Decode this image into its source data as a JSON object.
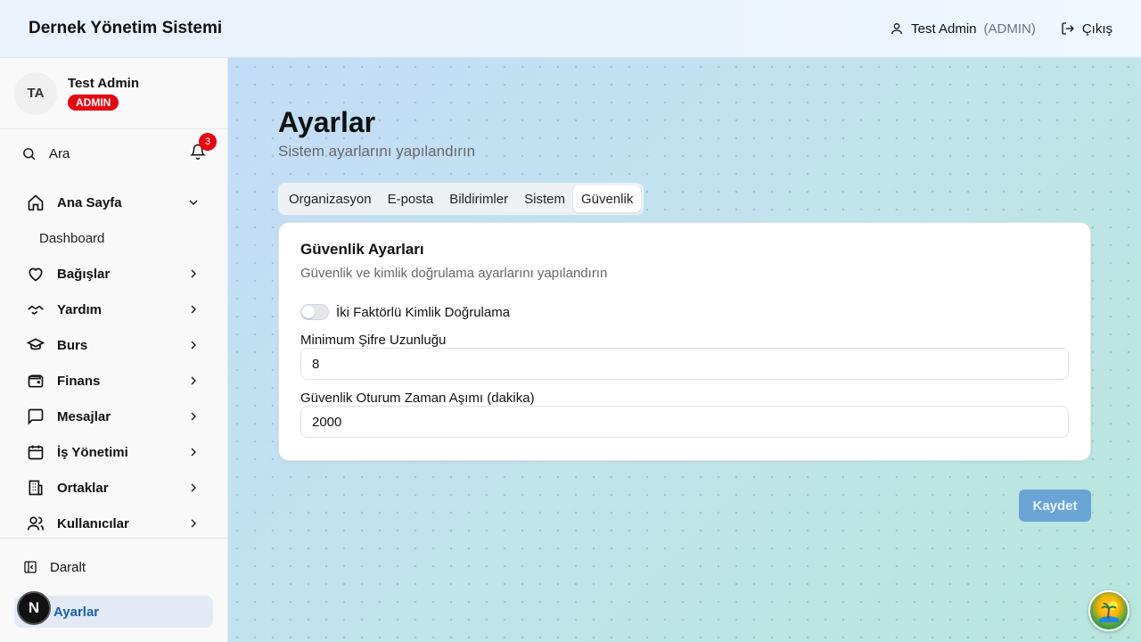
{
  "header": {
    "app_title": "Dernek Yönetim Sistemi",
    "user_name": "Test Admin",
    "user_role": "(ADMIN)",
    "logout_label": "Çıkış"
  },
  "sidebar": {
    "profile": {
      "initials": "TA",
      "name": "Test Admin",
      "role_badge": "ADMIN"
    },
    "search_label": "Ara",
    "notification_count": "3",
    "items": [
      {
        "label": "Ana Sayfa",
        "icon": "home-icon",
        "expanded": true
      },
      {
        "label": "Dashboard",
        "sub": true
      },
      {
        "label": "Bağışlar",
        "icon": "heart-icon"
      },
      {
        "label": "Yardım",
        "icon": "handshake-icon"
      },
      {
        "label": "Burs",
        "icon": "graduation-cap-icon"
      },
      {
        "label": "Finans",
        "icon": "wallet-icon"
      },
      {
        "label": "Mesajlar",
        "icon": "message-icon"
      },
      {
        "label": "İş Yönetimi",
        "icon": "calendar-icon"
      },
      {
        "label": "Ortaklar",
        "icon": "building-icon"
      },
      {
        "label": "Kullanıcılar",
        "icon": "users-icon"
      }
    ],
    "collapse_label": "Daralt",
    "active_label": "Ayarlar",
    "floating_initial": "N"
  },
  "main": {
    "title": "Ayarlar",
    "subtitle": "Sistem ayarlarını yapılandırın",
    "tabs": [
      "Organizasyon",
      "E-posta",
      "Bildirimler",
      "Sistem",
      "Güvenlik"
    ],
    "active_tab": "Güvenlik",
    "card": {
      "title": "Güvenlik Ayarları",
      "description": "Güvenlik ve kimlik doğrulama ayarlarını yapılandırın",
      "two_factor_label": "İki Faktörlü Kimlik Doğrulama",
      "two_factor_enabled": false,
      "min_password_label": "Minimum Şifre Uzunluğu",
      "min_password_value": "8",
      "session_timeout_label": "Güvenlik Oturum Zaman Aşımı (dakika)",
      "session_timeout_value": "2000"
    },
    "save_label": "Kaydet"
  },
  "colors": {
    "accent": "#6aa4d4",
    "badge_red": "#e30613",
    "active_nav": "#1e5fa8"
  }
}
